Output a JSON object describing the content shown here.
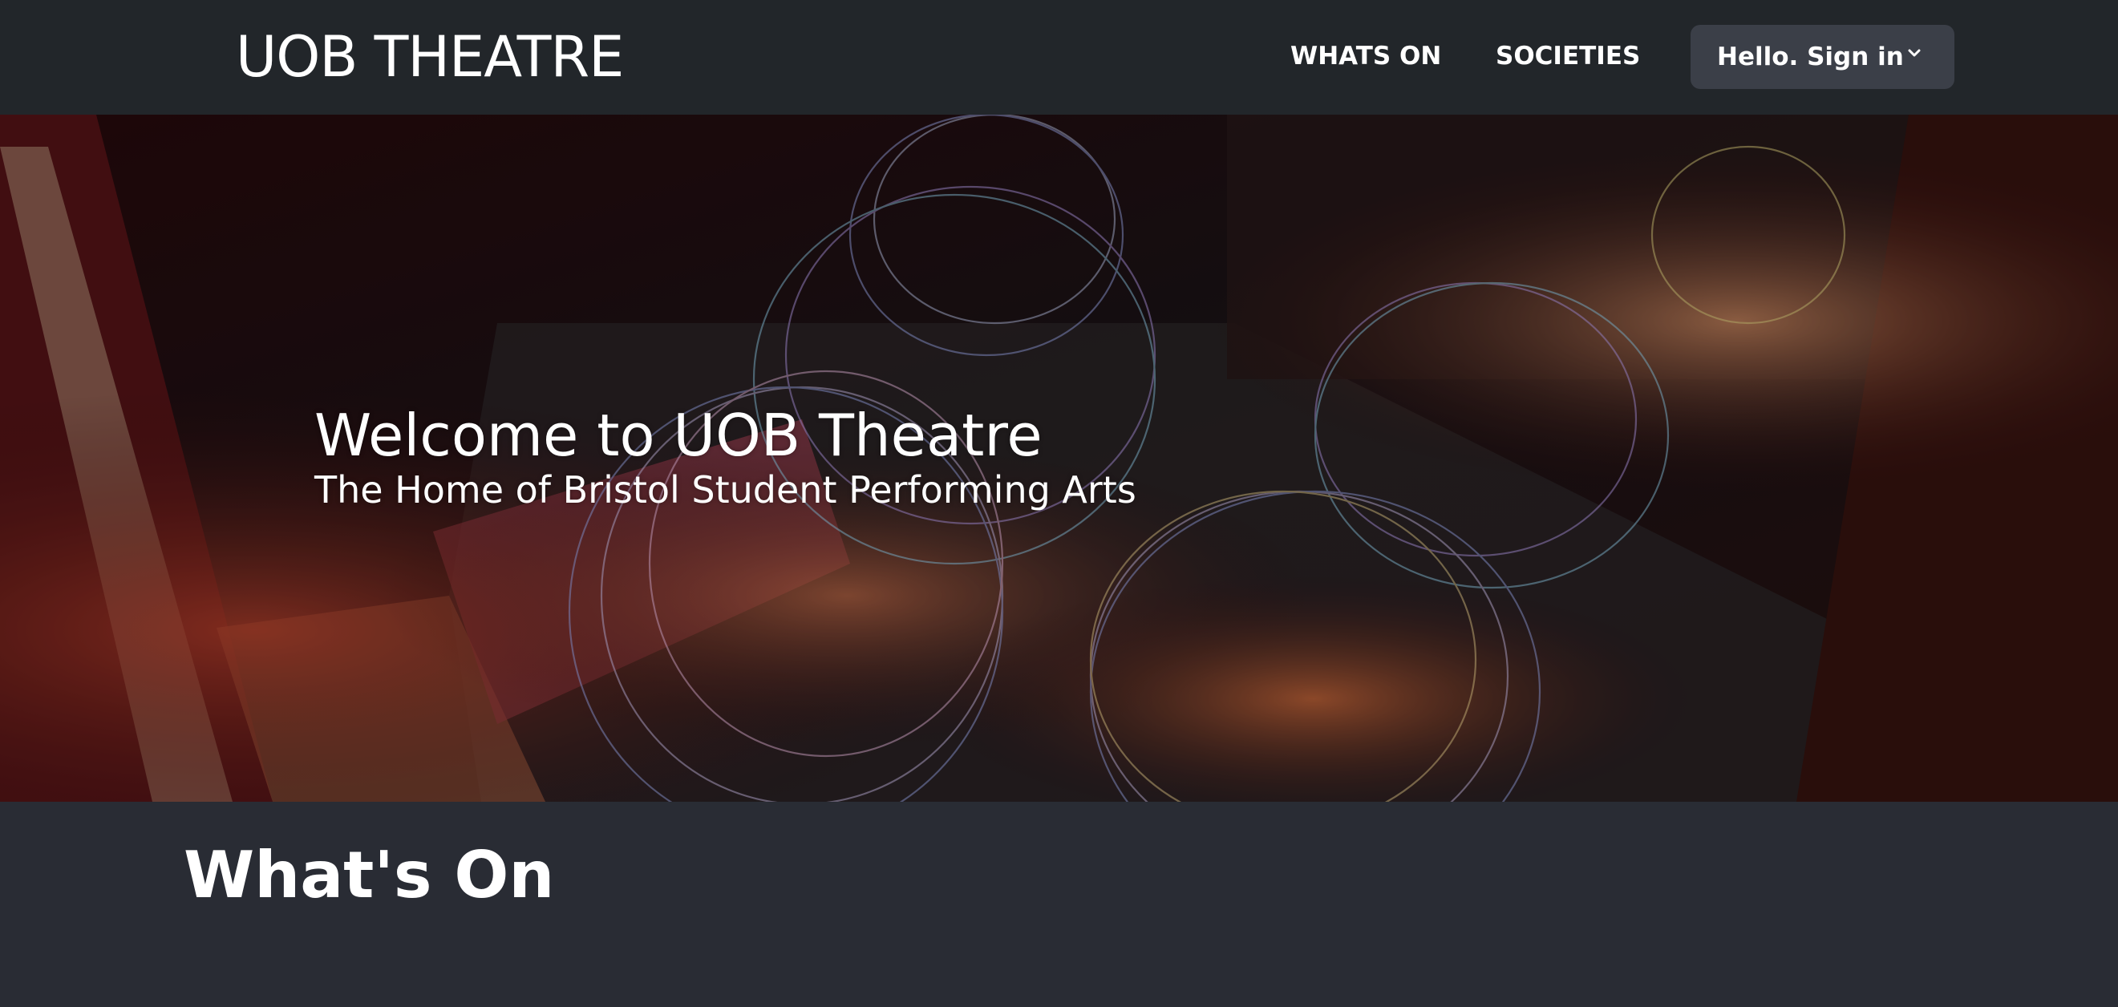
{
  "navbar": {
    "brand": "UOB THEATRE",
    "links": [
      {
        "label": "WHATS ON"
      },
      {
        "label": "SOCIETIES"
      }
    ],
    "signin": {
      "label": "Hello. Sign in",
      "icon": "chevron-down-icon"
    }
  },
  "hero": {
    "title": "Welcome to UOB Theatre",
    "subtitle": "The Home of Bristol Student Performing Arts"
  },
  "main": {
    "heading": "What's On"
  },
  "colors": {
    "navbar_bg": "#22262a",
    "signin_bg": "#3b3f48",
    "page_bg": "#292c34",
    "text": "#ffffff"
  }
}
